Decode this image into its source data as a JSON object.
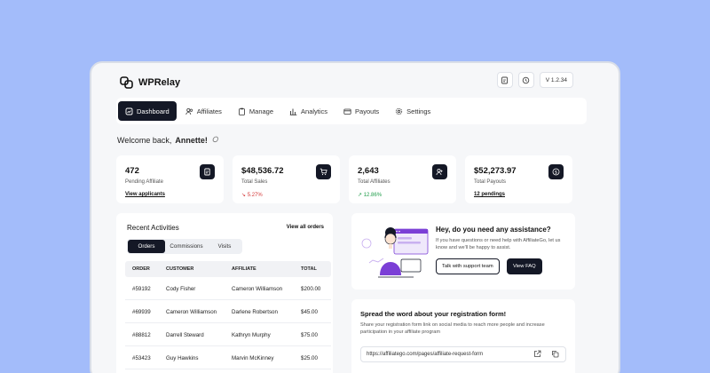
{
  "app": {
    "name": "WPRelay",
    "version": "V 1.2.34"
  },
  "nav": [
    {
      "label": "Dashboard",
      "icon": "dashboard-icon",
      "active": true
    },
    {
      "label": "Affiliates",
      "icon": "users-icon"
    },
    {
      "label": "Manage",
      "icon": "clipboard-icon"
    },
    {
      "label": "Analytics",
      "icon": "bar-chart-icon"
    },
    {
      "label": "Payouts",
      "icon": "wallet-icon"
    },
    {
      "label": "Settings",
      "icon": "gear-icon"
    }
  ],
  "welcome": {
    "prefix": "Welcome back,",
    "name": "Annette!"
  },
  "stats": [
    {
      "value": "472",
      "label": "Pending Affiliate",
      "sub": "View applicants",
      "sub_type": "link",
      "icon": "document-icon"
    },
    {
      "value": "$48,536.72",
      "label": "Total Sales",
      "sub": "5.27%",
      "sub_type": "down",
      "icon": "cart-icon"
    },
    {
      "value": "2,643",
      "label": "Total Affiliates",
      "sub": "12.86%",
      "sub_type": "up",
      "icon": "users-icon"
    },
    {
      "value": "$52,273.97",
      "label": "Total Payouts",
      "sub": "12 pendings",
      "sub_type": "link",
      "icon": "dollar-icon"
    }
  ],
  "activities": {
    "title": "Recent Activities",
    "view_all": "View all orders",
    "tabs": [
      "Orders",
      "Commissions",
      "Visits"
    ],
    "columns": [
      "ORDER",
      "CUSTOMER",
      "AFFILIATE",
      "TOTAL"
    ],
    "rows": [
      [
        "#59192",
        "Cody Fisher",
        "Cameron Williamson",
        "$200.00"
      ],
      [
        "#69939",
        "Cameron Williamson",
        "Darlene Robertson",
        "$45.00"
      ],
      [
        "#88812",
        "Darrell Steward",
        "Kathryn Murphy",
        "$75.00"
      ],
      [
        "#53423",
        "Guy Hawkins",
        "Marvin McKinney",
        "$25.00"
      ]
    ]
  },
  "help": {
    "title": "Hey, do you need any assistance?",
    "desc": "If you have questions or need help with AffiliateGo, let us know and we'll be happy to assist.",
    "btn_support": "Talk with support team",
    "btn_faq": "View FAQ"
  },
  "spread": {
    "title": "Spread the word about your registration form!",
    "desc": "Share your registration form link on social media to reach more people and increase participation in your affiliate program",
    "url": "https://affiliatego.com/pages/affiliate-request-form"
  },
  "colors": {
    "accent": "#141826",
    "background": "#a3bcfa",
    "illustration": "#7b3fd6"
  }
}
